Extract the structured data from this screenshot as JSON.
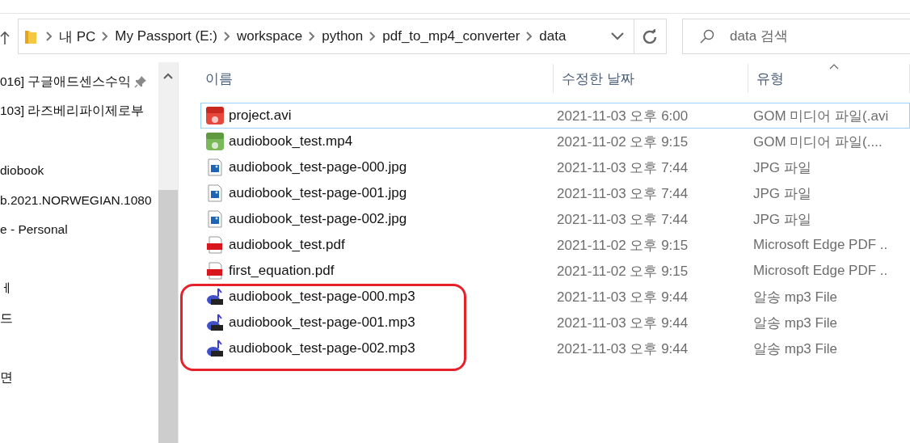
{
  "address_bar": {
    "path": [
      "내 PC",
      "My Passport (E:)",
      "workspace",
      "python",
      "pdf_to_mp4_converter",
      "data"
    ]
  },
  "search": {
    "placeholder": "data 검색"
  },
  "sidebar": {
    "items": [
      {
        "kind": "entry",
        "label": "016] 구글애드센스수익",
        "pinned": true
      },
      {
        "kind": "entry",
        "label": "103] 라즈베리파이제로부"
      },
      {
        "kind": "blank"
      },
      {
        "kind": "entry",
        "label": "diobook"
      },
      {
        "kind": "entry",
        "label": "b.2021.NORWEGIAN.1080"
      },
      {
        "kind": "entry",
        "label": "e - Personal"
      },
      {
        "kind": "blank"
      },
      {
        "kind": "entry",
        "label": "ㅔ"
      },
      {
        "kind": "entry",
        "label": "드"
      },
      {
        "kind": "blank"
      },
      {
        "kind": "entry",
        "label": "면"
      }
    ]
  },
  "table": {
    "columns": [
      "이름",
      "수정한 날짜",
      "유형"
    ],
    "rows": [
      {
        "kind": "avi",
        "name": "project.avi",
        "date": "2021-11-03 오후 6:00",
        "type": "GOM 미디어 파일(.avi",
        "selected": true
      },
      {
        "kind": "mp4",
        "name": "audiobook_test.mp4",
        "date": "2021-11-02 오후 9:15",
        "type": "GOM 미디어 파일(....",
        "selected": false
      },
      {
        "kind": "jpg",
        "name": "audiobook_test-page-000.jpg",
        "date": "2021-11-03 오후 7:44",
        "type": "JPG 파일",
        "selected": false
      },
      {
        "kind": "jpg",
        "name": "audiobook_test-page-001.jpg",
        "date": "2021-11-03 오후 7:44",
        "type": "JPG 파일",
        "selected": false
      },
      {
        "kind": "jpg",
        "name": "audiobook_test-page-002.jpg",
        "date": "2021-11-03 오후 7:44",
        "type": "JPG 파일",
        "selected": false
      },
      {
        "kind": "pdf",
        "name": "audiobook_test.pdf",
        "date": "2021-11-02 오후 9:15",
        "type": "Microsoft Edge PDF ..",
        "selected": false
      },
      {
        "kind": "pdf",
        "name": "first_equation.pdf",
        "date": "2021-11-02 오후 9:15",
        "type": "Microsoft Edge PDF ..",
        "selected": false
      },
      {
        "kind": "mp3",
        "name": "audiobook_test-page-000.mp3",
        "date": "2021-11-03 오후 9:44",
        "type": "알송 mp3 File",
        "selected": false
      },
      {
        "kind": "mp3",
        "name": "audiobook_test-page-001.mp3",
        "date": "2021-11-03 오후 9:44",
        "type": "알송 mp3 File",
        "selected": false
      },
      {
        "kind": "mp3",
        "name": "audiobook_test-page-002.mp3",
        "date": "2021-11-03 오후 9:44",
        "type": "알송 mp3 File",
        "selected": false
      }
    ]
  }
}
